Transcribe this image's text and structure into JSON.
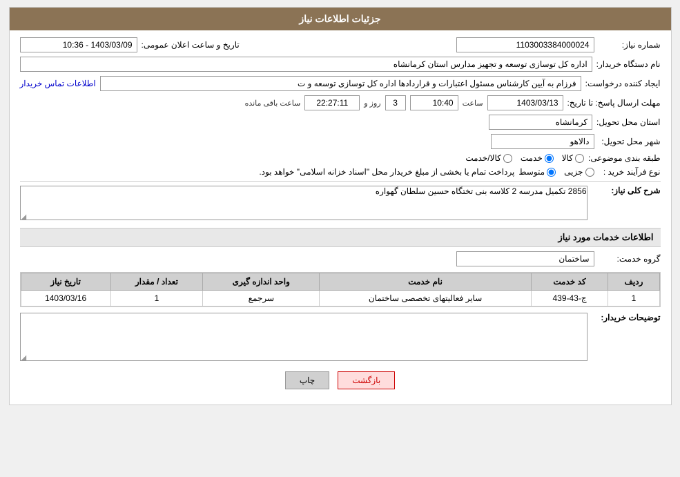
{
  "header": {
    "title": "جزئیات اطلاعات نیاز"
  },
  "fields": {
    "shomareNiaz_label": "شماره نیاز:",
    "shomareNiaz_value": "1103003384000024",
    "namDastgah_label": "نام دستگاه خریدار:",
    "namDastgah_value": "اداره کل توسازی  توسعه و تجهیز مدارس استان کرمانشاه",
    "ijadKonande_label": "ایجاد کننده درخواست:",
    "ijadKonande_value": "فرزام به آیین کارشناس مسئول اعتبارات و قراردادها اداره کل توسازی  توسعه و ت",
    "ijadKonande_link": "اطلاعات تماس خریدار",
    "mohlatErsalPasox_label": "مهلت ارسال پاسخ: تا تاریخ:",
    "date_value": "1403/03/13",
    "saat_label": "ساعت",
    "saat_value": "10:40",
    "roz_label": "روز و",
    "roz_value": "3",
    "mande_label": "ساعت باقی مانده",
    "mande_value": "22:27:11",
    "ostanMahal_label": "استان محل تحویل:",
    "ostanMahal_value": "کرمانشاه",
    "shahrMahal_label": "شهر محل تحویل:",
    "shahrMahal_value": "دالاهو",
    "tabaqeBandi_label": "طبقه بندی موضوعی:",
    "tabaqeBandi_kala": "کالا",
    "tabaqeBandi_khadamat": "خدمت",
    "tabaqeBandi_kala_khadamat": "کالا/خدمت",
    "noFarayand_label": "نوع فرآیند خرید :",
    "noFarayand_jozei": "جزیی",
    "noFarayand_mottaset": "متوسط",
    "noFarayand_notice": "پرداخت تمام یا بخشی از مبلغ خریدار محل \"اسناد خزانه اسلامی\" خواهد بود.",
    "announcement_label": "تاریخ و ساعت اعلان عمومی:",
    "announcement_value": "1403/03/09 - 10:36",
    "sharhKolliNiaz_label": "شرح کلی نیاز:",
    "sharhKolliNiaz_value": "2856 تکمیل مدرسه 2 کلاسه بنی تختگاه حسین سلطان گهواره",
    "khadamatSection": {
      "title": "اطلاعات خدمات مورد نیاز",
      "groohKhadamat_label": "گروه خدمت:",
      "groohKhadamat_value": "ساختمان",
      "table": {
        "headers": [
          "ردیف",
          "کد خدمت",
          "نام خدمت",
          "واحد اندازه گیری",
          "تعداد / مقدار",
          "تاریخ نیاز"
        ],
        "rows": [
          {
            "radif": "1",
            "kodKhadamat": "ج-43-439",
            "namKhadamat": "سایر فعالیتهای تخصصی ساختمان",
            "vahed": "سرجمع",
            "tedad": "1",
            "tarikh": "1403/03/16"
          }
        ]
      }
    },
    "tosifatKharidar_label": "توضیحات خریدار:",
    "tosifatKharidar_value": ""
  },
  "buttons": {
    "print_label": "چاپ",
    "back_label": "بازگشت"
  }
}
